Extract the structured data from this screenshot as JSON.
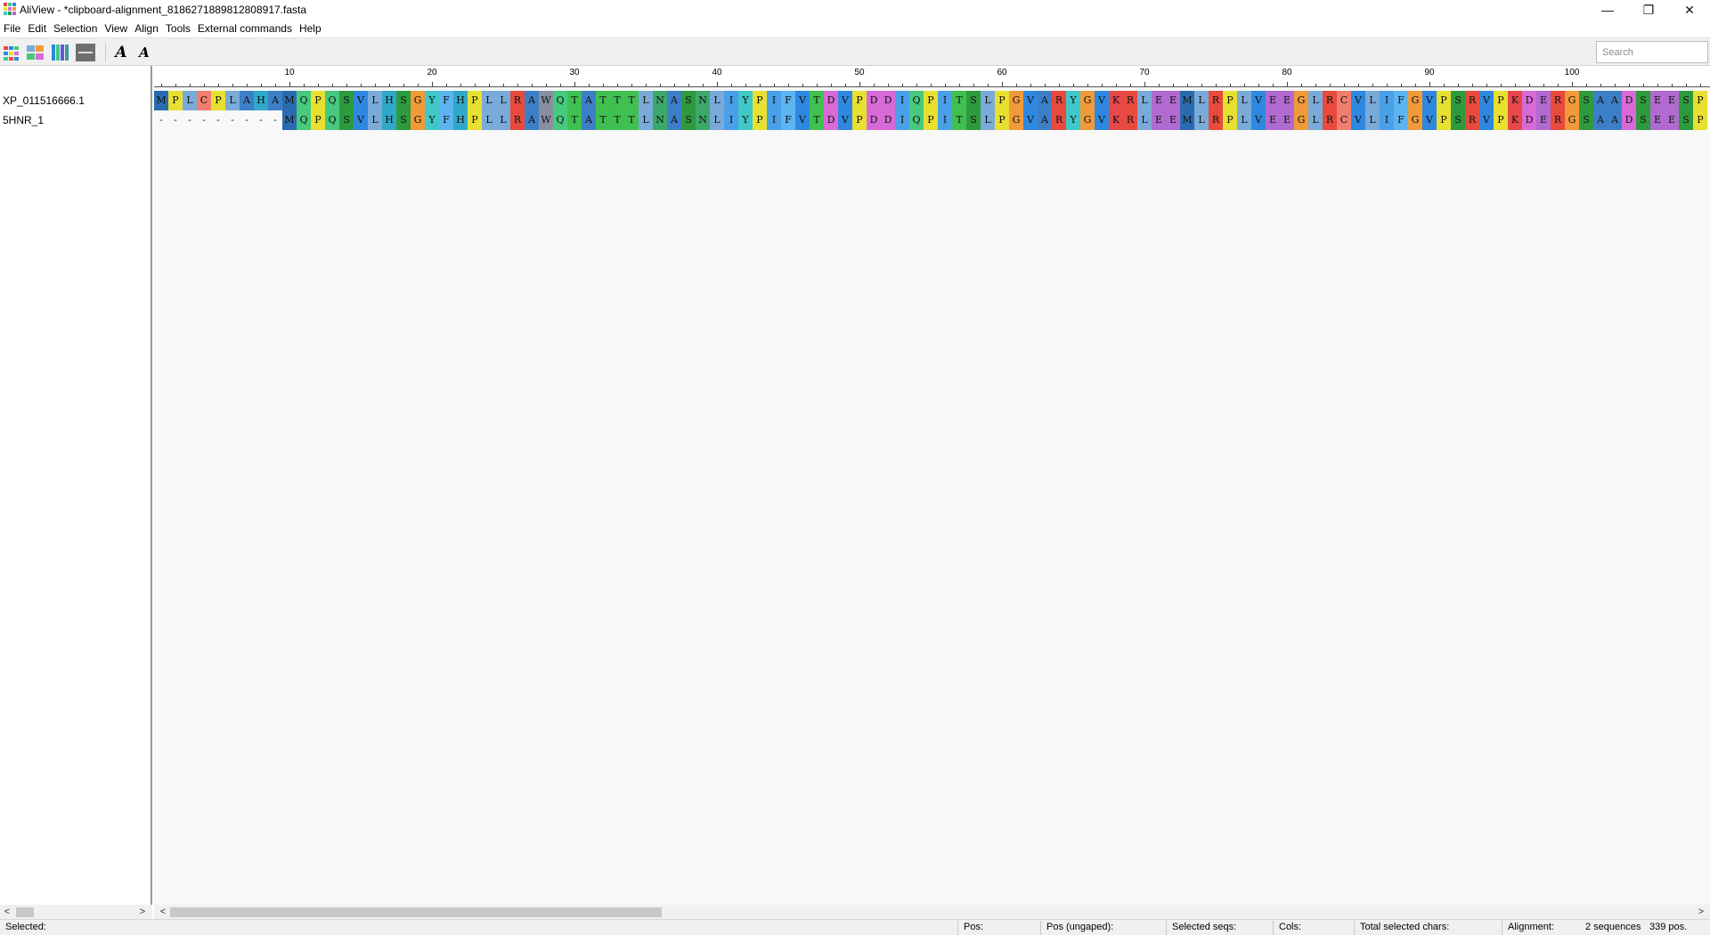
{
  "window": {
    "title": "AliView - *clipboard-alignment_8186271889812808917.fasta",
    "minimize_glyph": "—",
    "maximize_glyph": "❐",
    "close_glyph": "✕"
  },
  "menu": [
    "File",
    "Edit",
    "Selection",
    "View",
    "Align",
    "Tools",
    "External commands",
    "Help"
  ],
  "toolbar": {
    "icons": [
      "color-scheme-icon",
      "nucleotide-view-icon",
      "amino-acid-view-icon",
      "translate-icon",
      "font-increase-icon",
      "font-decrease-icon"
    ],
    "font_increase_glyph": "A",
    "font_decrease_glyph": "A",
    "search_placeholder": "Search"
  },
  "ruler": {
    "labels": [
      "10",
      "20",
      "30",
      "40",
      "50",
      "60",
      "70",
      "80",
      "90",
      "100"
    ]
  },
  "sequences": [
    {
      "name": "XP_011516666.1",
      "residues": "MPLCPLAHAMQPQSVLHSGYFHPLLRAWQTATTTLNASNLIYPIFVTDVPDDIQPITSLPGVARYGVKRLEEMLRPLVEEGLRCVLIFGVPSRVPKDERGSAADSEESP"
    },
    {
      "name": "5HNR_1",
      "residues": "---------MQPQSVLHSGYFHPLLRAWQTATTTLNASNLIYPIFVTDVPDDIQPITSLPGVARYGVKRLEEMLRPLVEEGLRCVLIFGVPSRVPKDERGSAADSEESP"
    }
  ],
  "residue_colors": {
    "A": "#3d7fc7",
    "R": "#e84a3d",
    "N": "#3ca86a",
    "D": "#d86ad8",
    "C": "#f07e6f",
    "Q": "#47c97e",
    "E": "#b06ad0",
    "G": "#f09a3a",
    "H": "#30a8c8",
    "I": "#4aa0e8",
    "L": "#7aaad8",
    "K": "#e8484a",
    "M": "#2a6bb0",
    "F": "#5cb4f0",
    "P": "#e8e030",
    "S": "#2e9a3e",
    "T": "#40c050",
    "W": "#8890a0",
    "Y": "#40c8c8",
    "V": "#2e88e0",
    "-": "#f8f8f8"
  },
  "scroll": {
    "left_arrow": "<",
    "right_arrow": ">"
  },
  "status": {
    "selected": "Selected:",
    "pos": "Pos:",
    "pos_ungaped": "Pos (ungaped):",
    "selected_seqs": "Selected seqs:",
    "cols": "Cols:",
    "total_selected_chars": "Total selected chars:",
    "alignment_label": "Alignment:",
    "sequence_count": "2 sequences",
    "positions": "339 pos."
  }
}
